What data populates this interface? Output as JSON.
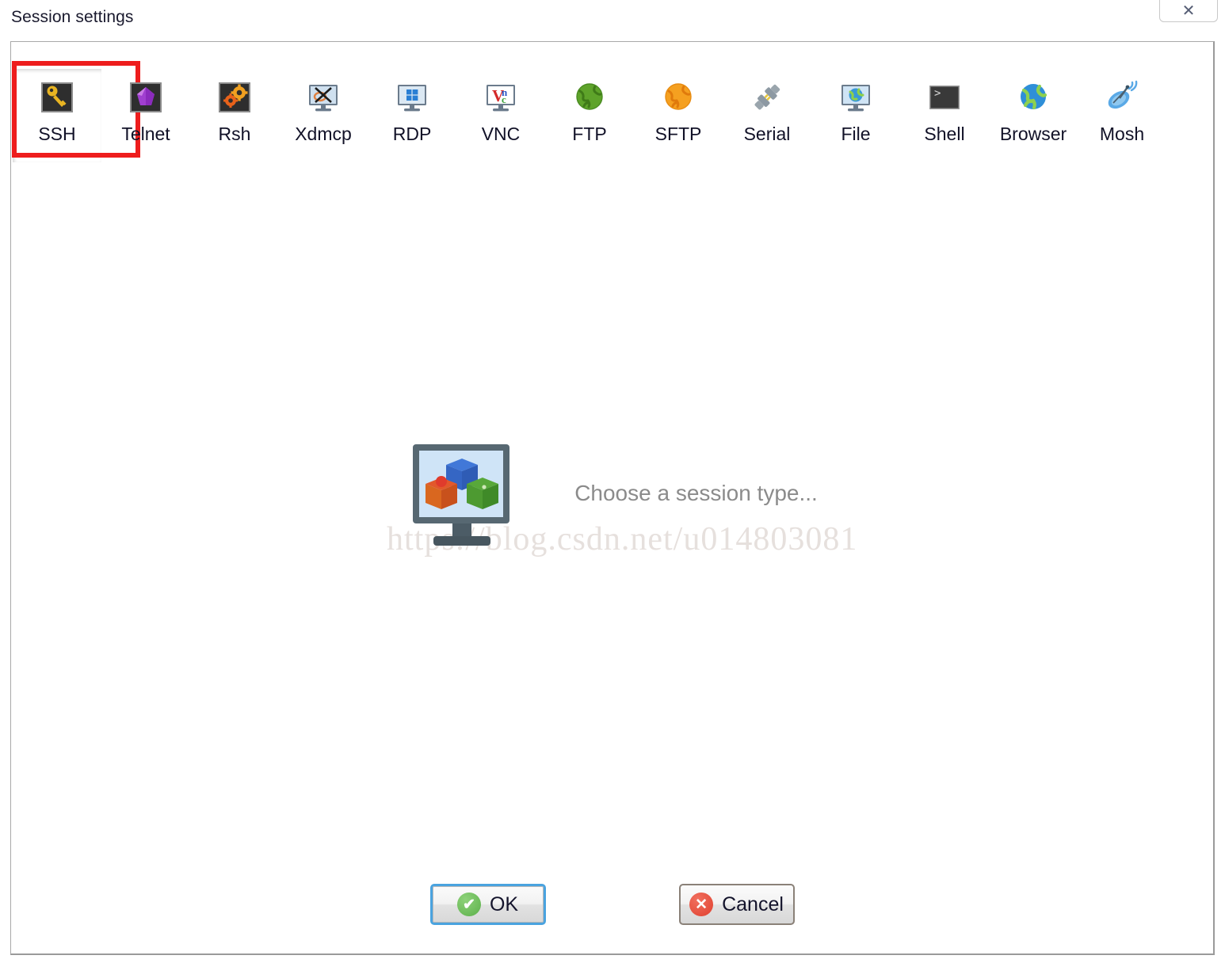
{
  "window": {
    "title": "Session settings",
    "close_label": "✕",
    "close_icon": "close-icon"
  },
  "toolbar": {
    "selected": "SSH",
    "items": [
      {
        "label": "SSH",
        "icon": "key-icon"
      },
      {
        "label": "Telnet",
        "icon": "gem-icon"
      },
      {
        "label": "Rsh",
        "icon": "gears-icon"
      },
      {
        "label": "Xdmcp",
        "icon": "monitor-x-icon"
      },
      {
        "label": "RDP",
        "icon": "monitor-windows-icon"
      },
      {
        "label": "VNC",
        "icon": "monitor-vnc-icon"
      },
      {
        "label": "FTP",
        "icon": "globe-green-icon"
      },
      {
        "label": "SFTP",
        "icon": "globe-orange-icon"
      },
      {
        "label": "Serial",
        "icon": "plug-icon"
      },
      {
        "label": "File",
        "icon": "monitor-globe-icon"
      },
      {
        "label": "Shell",
        "icon": "terminal-icon"
      },
      {
        "label": "Browser",
        "icon": "globe-blue-icon"
      },
      {
        "label": "Mosh",
        "icon": "satellite-dish-icon"
      }
    ]
  },
  "main": {
    "placeholder_text": "Choose a session type...",
    "placeholder_icon": "monitor-cubes-icon",
    "watermark": "https://blog.csdn.net/u014803081"
  },
  "buttons": {
    "ok_label": "OK",
    "ok_badge": "✔",
    "cancel_label": "Cancel",
    "cancel_badge": "✕"
  },
  "colors": {
    "selection_outline": "#ee1d1d",
    "ok_focus_border": "#4aa3df",
    "ok_badge": "#5cb04a",
    "cancel_badge": "#e0402f",
    "panel_border": "#a8a8a8",
    "watermark": "#e6e0dd"
  }
}
